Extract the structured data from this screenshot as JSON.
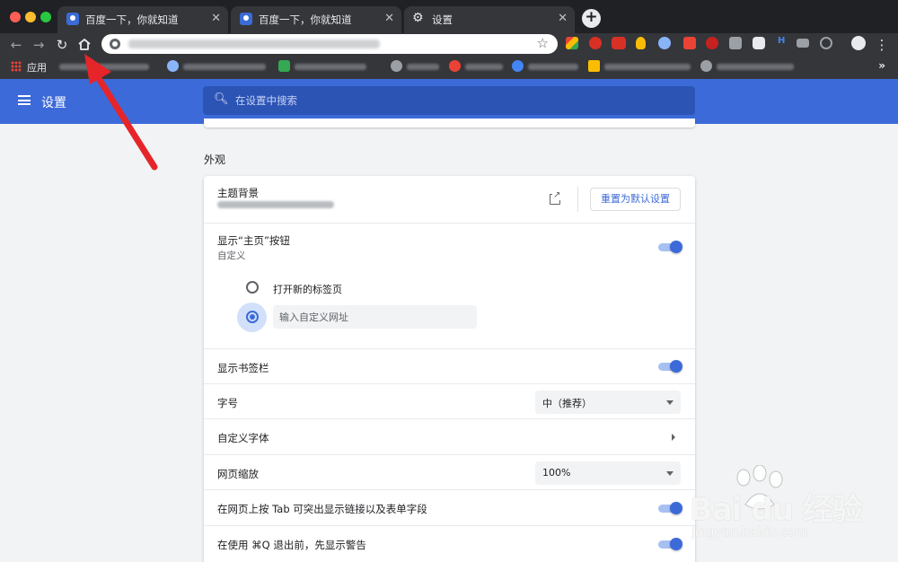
{
  "browser": {
    "tabs": [
      {
        "title": "百度一下，你就知道",
        "close": "✕"
      },
      {
        "title": "百度一下，你就知道",
        "close": "✕"
      },
      {
        "title": "设置",
        "close": "✕"
      }
    ],
    "new_tab": "+",
    "apps_label": "应用",
    "bookmarks_overflow": "»"
  },
  "header": {
    "title": "设置",
    "search_placeholder": "在设置中搜索"
  },
  "appearance": {
    "section_title": "外观",
    "theme": {
      "label": "主题背景",
      "reset_button": "重置为默认设置"
    },
    "home_button": {
      "label": "显示“主页”按钮",
      "sublabel": "自定义",
      "enabled": true,
      "option_new_tab": "打开新的标签页",
      "custom_url_placeholder": "输入自定义网址"
    },
    "bookmarks_bar": {
      "label": "显示书签栏",
      "enabled": true
    },
    "font_size": {
      "label": "字号",
      "value": "中（推荐）"
    },
    "custom_fonts": {
      "label": "自定义字体"
    },
    "page_zoom": {
      "label": "网页缩放",
      "value": "100%"
    },
    "tab_highlight": {
      "label": "在网页上按 Tab 可突出显示链接以及表单字段",
      "enabled": true
    },
    "quit_warning": {
      "label": "在使用 ⌘Q 退出前，先显示警告",
      "enabled": true
    }
  },
  "watermark": {
    "brand": "Bai du 经验",
    "url": "jingyan.baidu.com"
  },
  "colors": {
    "header_blue": "#3c6ad9",
    "annotation_red": "#e5252a"
  }
}
